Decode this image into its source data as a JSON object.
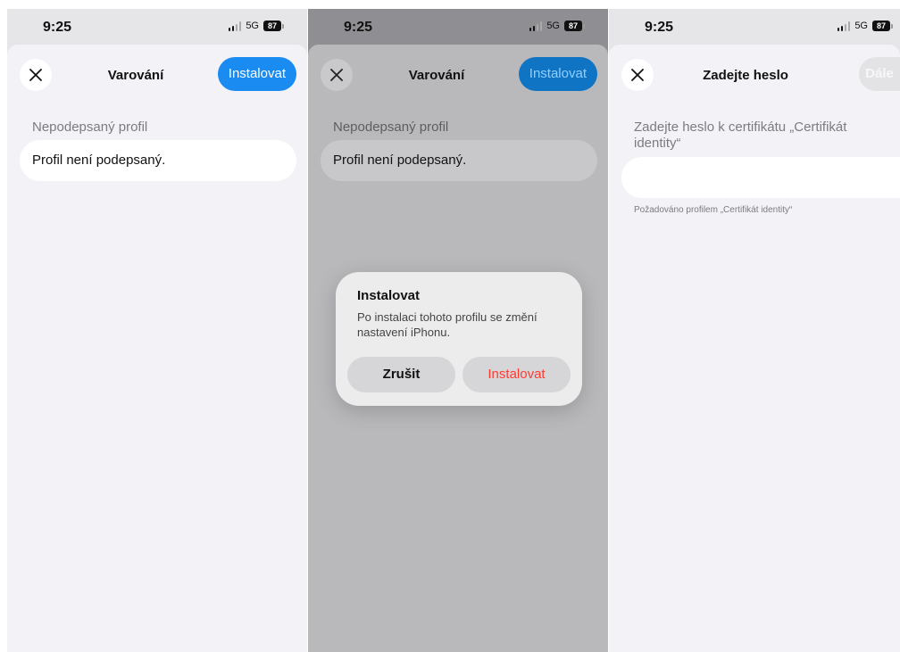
{
  "status_bar": {
    "time": "9:25",
    "network": "5G",
    "battery": "87"
  },
  "screen1": {
    "nav_title": "Varování",
    "install_label": "Instalovat",
    "section_header": "Nepodepsaný profil",
    "cell_text": "Profil není podepsaný."
  },
  "screen2": {
    "nav_title": "Varování",
    "install_label": "Instalovat",
    "section_header": "Nepodepsaný profil",
    "cell_text": "Profil není podepsaný.",
    "alert": {
      "title": "Instalovat",
      "message": "Po instalaci tohoto profilu se změní nastavení iPhonu.",
      "cancel_label": "Zrušit",
      "confirm_label": "Instalovat"
    }
  },
  "screen3": {
    "nav_title": "Zadejte heslo",
    "next_label": "Dále",
    "prompt": "Zadejte heslo k certifikátu „Certifikát identity“",
    "password_value": "",
    "footer": "Požadováno profilem „Certifikát identity“"
  },
  "colors": {
    "accent": "#1a8bf0",
    "destructive": "#ff3b30",
    "background": "#f2f2f7"
  },
  "icons": {
    "close": "close-icon",
    "signal": "signal-icon",
    "battery": "battery-icon"
  }
}
